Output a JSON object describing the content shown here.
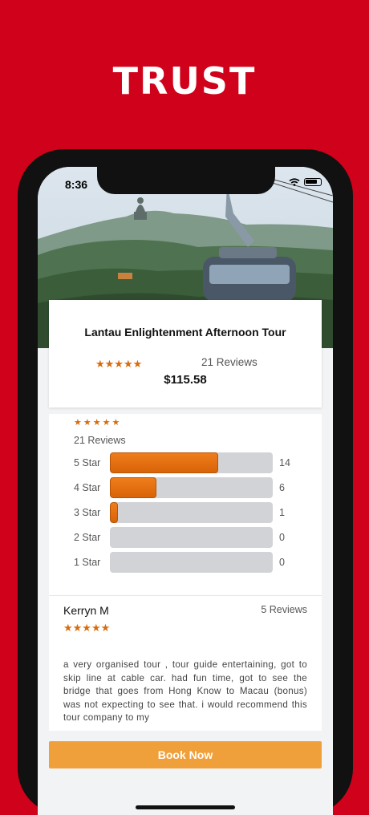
{
  "headline": "TRUST",
  "status_bar": {
    "time": "8:36"
  },
  "tour": {
    "title": "Lantau Enlightenment Afternoon Tour",
    "stars": "★★★★★",
    "reviews_label": "21 Reviews",
    "price": "$115.58",
    "rating": 5
  },
  "ratings": {
    "stars": "★★★★★",
    "total_label": "21 Reviews",
    "rows": [
      {
        "label": "5 Star",
        "count": "14",
        "fraction": 0.667
      },
      {
        "label": "4 Star",
        "count": "6",
        "fraction": 0.286
      },
      {
        "label": "3 Star",
        "count": "1",
        "fraction": 0.048
      },
      {
        "label": "2 Star",
        "count": "0",
        "fraction": 0
      },
      {
        "label": "1 Star",
        "count": "0",
        "fraction": 0
      }
    ]
  },
  "review": {
    "author": "Kerryn M",
    "author_reviews": "5 Reviews",
    "stars": "★★★★★",
    "text": "a very organised tour , tour guide entertaining, got to skip line at cable car. had fun time, got to see the bridge that goes from Hong Know to Macau (bonus) was not expecting to see that. i would recommend this tour company to my"
  },
  "actions": {
    "book_now": "Book Now"
  },
  "colors": {
    "brand_red": "#d0021b",
    "accent_orange": "#e8770f",
    "button_orange": "#f0a03a"
  },
  "icons": [
    "wifi-icon",
    "battery-icon",
    "star-icon"
  ]
}
